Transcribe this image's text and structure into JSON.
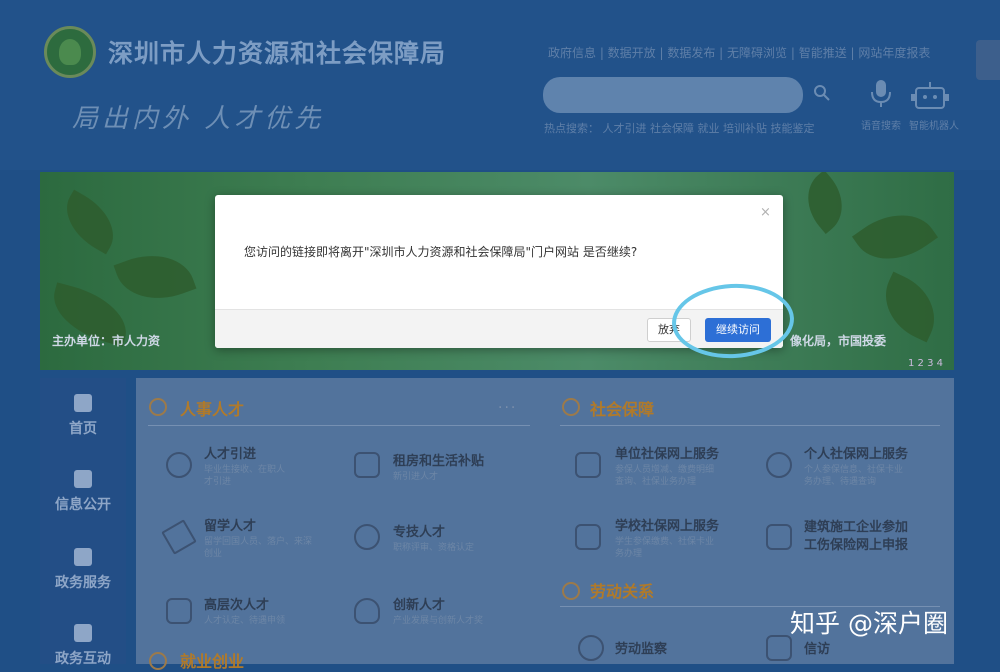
{
  "header": {
    "site_title": "深圳市人力资源和社会保障局",
    "slogan": "局出内外  人才优先",
    "top_links": "政府信息 | 数据开放 | 数据发布 | 无障碍浏览 | 智能推送 | 网站年度报表",
    "search_placeholder": "",
    "hot_search": "热点搜索：  人才引进  社会保障  就业  培训补贴  技能鉴定",
    "voice_label": "语音搜索",
    "robot_label": "智能机器人"
  },
  "banner": {
    "left_text": "主办单位：市人力资",
    "right_text": "像化局，市国投委",
    "dots": "1 2 3 4"
  },
  "sidenav": {
    "items": [
      {
        "label": "首页"
      },
      {
        "label": "信息公开"
      },
      {
        "label": "政务服务"
      },
      {
        "label": "政务互动"
      }
    ]
  },
  "sections": {
    "hr_talent": {
      "title": "人事人才",
      "items": [
        {
          "title": "人才引进",
          "desc": "毕业生接收、在职人\n才引进"
        },
        {
          "title": "租房和生活补贴",
          "desc": "新引进人才"
        },
        {
          "title": "留学人才",
          "desc": "留学回国人员、落户、来深\n创业"
        },
        {
          "title": "专技人才",
          "desc": "职称评审、资格认定"
        },
        {
          "title": "高层次人才",
          "desc": "人才认定、待遇申领"
        },
        {
          "title": "创新人才",
          "desc": "产业发展与创新人才奖"
        }
      ]
    },
    "social_security": {
      "title": "社会保障",
      "items": [
        {
          "title": "单位社保网上服务",
          "desc": "参保人员增减、缴费明细\n查询、社保业务办理"
        },
        {
          "title": "个人社保网上服务",
          "desc": "个人参保信息、社保卡业\n务办理、待遇查询"
        },
        {
          "title": "学校社保网上服务",
          "desc": "学生参保缴费、社保卡业\n务办理"
        },
        {
          "title": "建筑施工企业参加\n工伤保险网上申报",
          "desc": ""
        }
      ]
    },
    "labor_relations": {
      "title": "劳动关系",
      "items": [
        {
          "title": "劳动监察"
        },
        {
          "title": "信访"
        }
      ]
    },
    "employment": {
      "title": "就业创业"
    }
  },
  "modal": {
    "message": "您访问的链接即将离开\"深圳市人力资源和社会保障局\"门户网站 是否继续?",
    "close_symbol": "×",
    "cancel_label": "放弃",
    "continue_label": "继续访问"
  },
  "watermark": "知乎 @深户圈",
  "colors": {
    "accent_blue": "#2d6fd6",
    "highlight_circle": "#66c6e8"
  }
}
